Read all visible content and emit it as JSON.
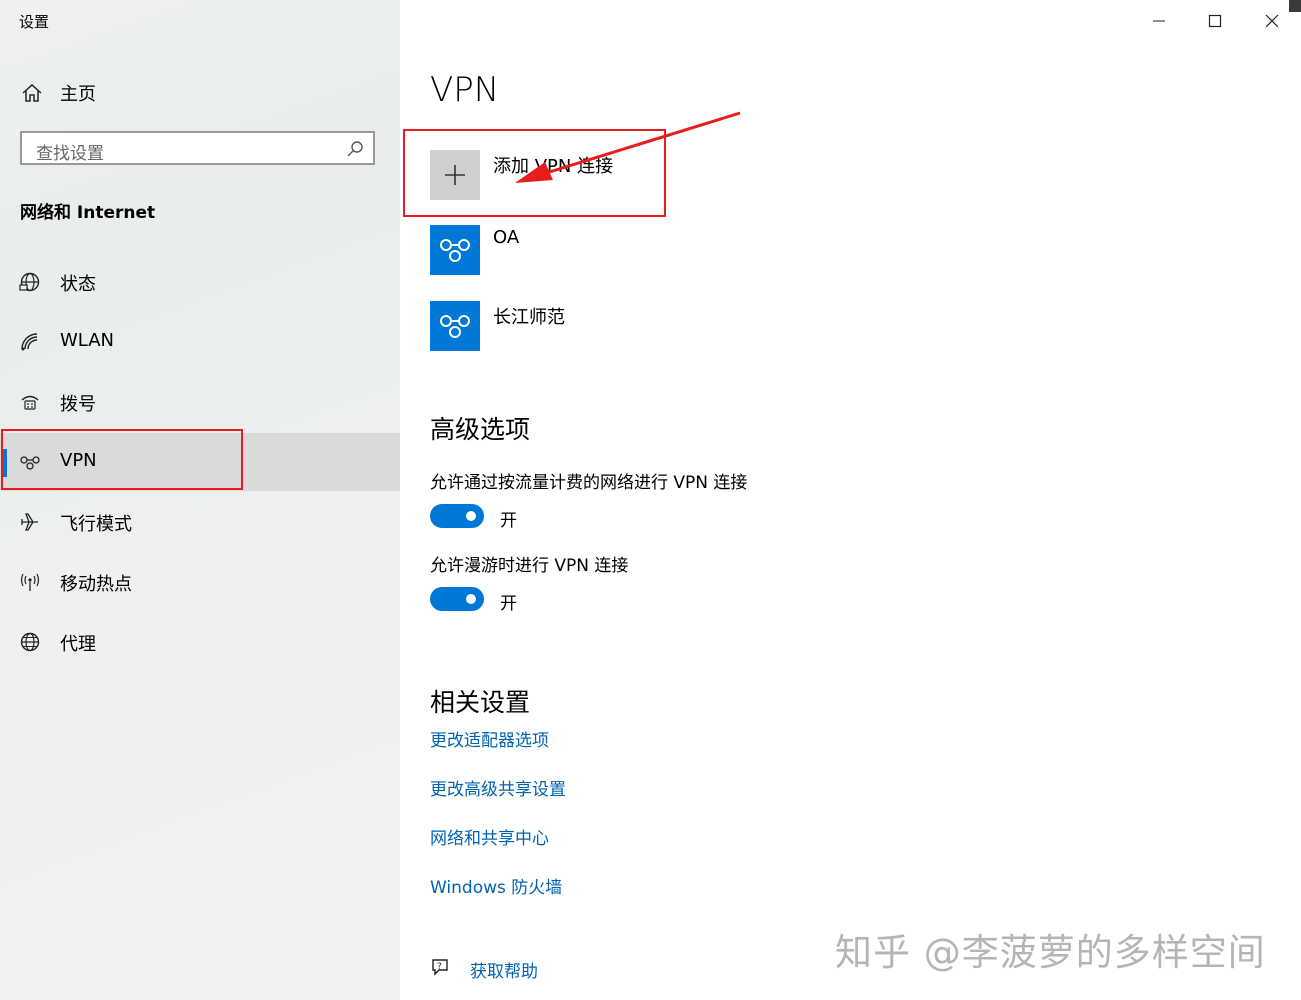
{
  "window": {
    "title": "设置"
  },
  "sidebar": {
    "home_label": "主页",
    "search_placeholder": "查找设置",
    "section_title": "网络和 Internet",
    "items": [
      {
        "label": "状态",
        "icon": "globe-status-icon"
      },
      {
        "label": "WLAN",
        "icon": "wifi-icon"
      },
      {
        "label": "拨号",
        "icon": "dialup-icon"
      },
      {
        "label": "VPN",
        "icon": "vpn-icon",
        "selected": true
      },
      {
        "label": "飞行模式",
        "icon": "airplane-icon"
      },
      {
        "label": "移动热点",
        "icon": "hotspot-icon"
      },
      {
        "label": "代理",
        "icon": "globe-icon"
      }
    ]
  },
  "main": {
    "title": "VPN",
    "add_vpn_label": "添加 VPN 连接",
    "connections": [
      {
        "name": "OA"
      },
      {
        "name": "长江师范"
      }
    ],
    "advanced": {
      "heading": "高级选项",
      "options": [
        {
          "label": "允许通过按流量计费的网络进行 VPN 连接",
          "state": "开",
          "on": true
        },
        {
          "label": "允许漫游时进行 VPN 连接",
          "state": "开",
          "on": true
        }
      ]
    },
    "related": {
      "heading": "相关设置",
      "links": [
        "更改适配器选项",
        "更改高级共享设置",
        "网络和共享中心",
        "Windows 防火墙"
      ]
    },
    "help_label": "获取帮助"
  },
  "watermark": "知乎 @李菠萝的多样空间",
  "colors": {
    "accent": "#0078d7",
    "link": "#0063b1",
    "annotation": "#e81c1c"
  }
}
